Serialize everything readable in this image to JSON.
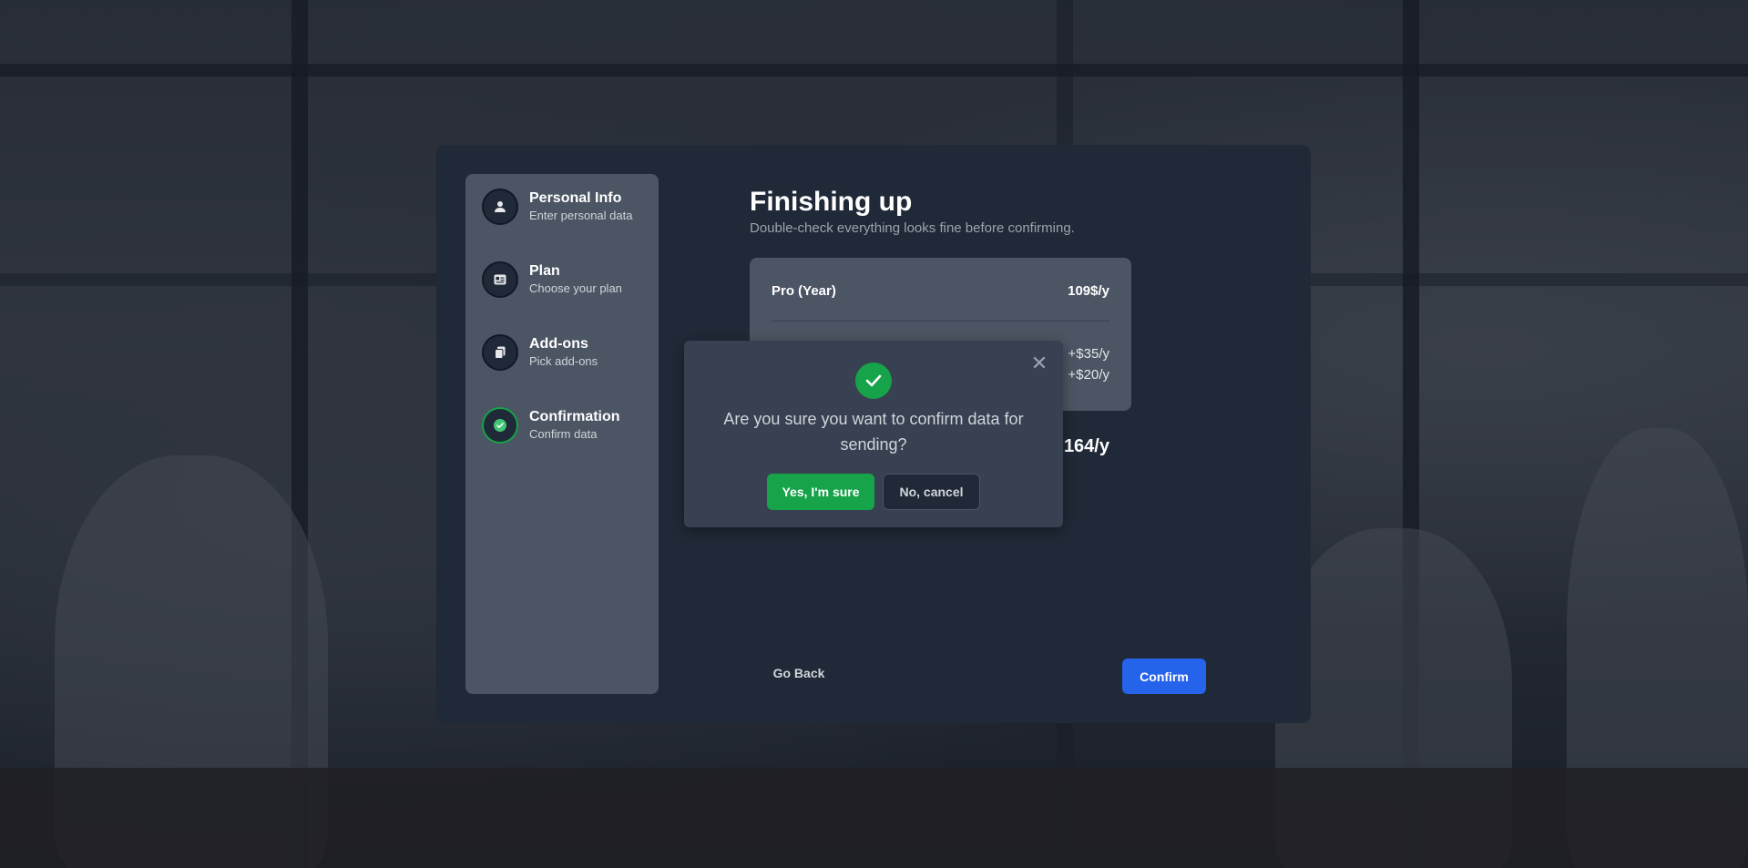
{
  "steps": [
    {
      "title": "Personal Info",
      "subtitle": "Enter personal data",
      "icon": "user-icon"
    },
    {
      "title": "Plan",
      "subtitle": "Choose your plan",
      "icon": "id-card-icon"
    },
    {
      "title": "Add-ons",
      "subtitle": "Pick add-ons",
      "icon": "copy-icon"
    },
    {
      "title": "Confirmation",
      "subtitle": "Confirm data",
      "icon": "check-circle-icon"
    }
  ],
  "main": {
    "heading": "Finishing up",
    "subheading": "Double-check everything looks fine before confirming."
  },
  "summary": {
    "plan_name": "Pro (Year)",
    "plan_price": "109$/y",
    "addons": [
      {
        "price": "+$35/y"
      },
      {
        "price": "+$20/y"
      }
    ],
    "total_value": "164/y"
  },
  "actions": {
    "go_back": "Go Back",
    "confirm": "Confirm"
  },
  "modal": {
    "message": "Are you sure you want to confirm data for sending?",
    "yes_label": "Yes, I'm sure",
    "no_label": "No, cancel",
    "close_glyph": "✕"
  },
  "colors": {
    "card_bg": "#1f2937",
    "sidebar_bg": "#4b5563",
    "accent_blue": "#2563eb",
    "success_green": "#16a34a",
    "modal_bg": "#374151"
  }
}
